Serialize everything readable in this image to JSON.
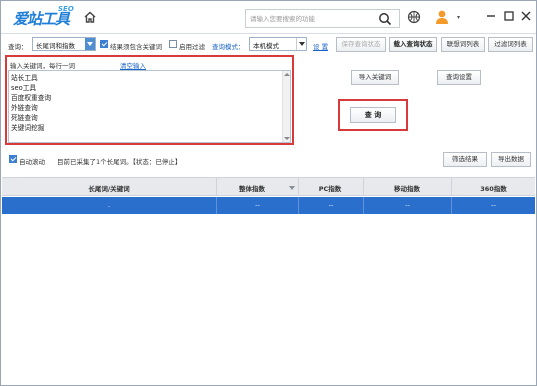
{
  "app": {
    "logo_text": "爱站工具包",
    "logo_main": "爱站工具",
    "logo_sup": "SEO"
  },
  "header": {
    "search_placeholder": "请输入您要搜索的功能"
  },
  "toolbar": {
    "query_label": "查询：",
    "query_type_value": "长尾词和指数",
    "must_contain_label": "结果须包含关键词",
    "must_contain_checked": true,
    "enable_filter_label": "启用过滤",
    "enable_filter_checked": false,
    "query_mode_label": "查询模式：",
    "query_mode_value": "本机模式",
    "settings_link": "设 置",
    "save_status_button": "保存查询状态",
    "import_status_button": "载入查询状态",
    "suggest_list_button": "联想词列表",
    "filter_list_button": "过滤词列表"
  },
  "keyword_panel": {
    "heading": "输入关键词，每行一词",
    "clear_link": "清空输入",
    "lines": [
      "站长工具",
      "seo工具",
      "百度权重查询",
      "外链查询",
      "死链查询",
      "关键词挖掘"
    ]
  },
  "actions": {
    "import_keywords_button": "导入关键词",
    "query_settings_button": "查询设置",
    "query_button": "查 询"
  },
  "status": {
    "auto_scroll_label": "自动滚动",
    "auto_scroll_checked": true,
    "summary_text": "目前已采集了1个长尾词。【状态：已停止】",
    "filter_results_button": "筛选结果",
    "export_data_button": "导出数据"
  },
  "table": {
    "columns": [
      "长尾词/关键词",
      "整体指数",
      "PC指数",
      "移动指数",
      "360指数"
    ],
    "rows": [
      [
        ".",
        "--",
        "--",
        "--",
        "--"
      ]
    ]
  },
  "colors": {
    "accent": "#2a6fcb",
    "highlight_border": "#d63a3a",
    "link": "#1a64c8"
  }
}
